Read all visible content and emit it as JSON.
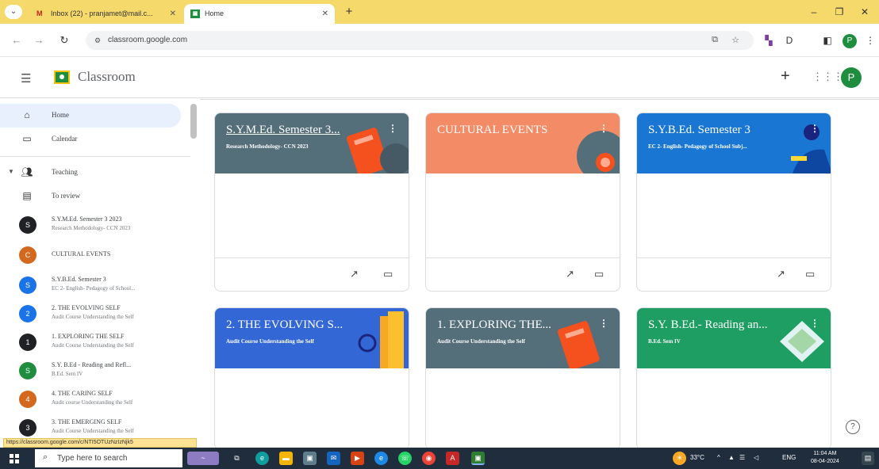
{
  "browser": {
    "tabs": [
      {
        "title": "Inbox (22) - pranjamet@mail.c...",
        "active": false
      },
      {
        "title": "Home",
        "active": true
      }
    ],
    "url": "classroom.google.com",
    "profile_initial": "P"
  },
  "app": {
    "title": "Classroom",
    "avatar_initial": "P"
  },
  "sidebar": {
    "home": "Home",
    "calendar": "Calendar",
    "teaching": "Teaching",
    "to_review": "To review",
    "classes": [
      {
        "initial": "S",
        "color": "#202124",
        "title": "S.Y.M.Ed. Semester 3 2023",
        "subtitle": "Research Methodology- CCN 2023"
      },
      {
        "initial": "C",
        "color": "#d2691e",
        "title": "CULTURAL EVENTS",
        "subtitle": ""
      },
      {
        "initial": "S",
        "color": "#1a73e8",
        "title": "S.Y.B.Ed. Semester 3",
        "subtitle": "EC 2- English- Pedagogy of School..."
      },
      {
        "initial": "2",
        "color": "#1a73e8",
        "title": "2. THE EVOLVING SELF",
        "subtitle": "Audit Course Understanding the Self"
      },
      {
        "initial": "1",
        "color": "#202124",
        "title": "1. EXPLORING THE SELF",
        "subtitle": "Audit Course Understanding the Self"
      },
      {
        "initial": "S",
        "color": "#1e8e3e",
        "title": "S.Y. B.Ed - Reading and Refl...",
        "subtitle": "B.Ed. Sem IV"
      },
      {
        "initial": "4",
        "color": "#d2691e",
        "title": "4. THE CARING SELF",
        "subtitle": "Audit course Understanding the Self"
      },
      {
        "initial": "3",
        "color": "#202124",
        "title": "3. THE EMERGING SELF",
        "subtitle": "Audit Course Understanding the Self"
      }
    ],
    "status_url": "https://classroom.google.com/c/NTI5OTUzNzIzNjk5"
  },
  "cards": [
    {
      "title": "S.Y.M.Ed. Semester 3...",
      "subtitle": "Research Methodology- CCN 2023",
      "color": "#546e7a"
    },
    {
      "title": "CULTURAL EVENTS",
      "subtitle": "",
      "color": "#f28b66"
    },
    {
      "title": "S.Y.B.Ed. Semester 3",
      "subtitle": "EC 2- English- Pedagogy of School Subj...",
      "color": "#1976d2"
    },
    {
      "title": "2. THE EVOLVING S...",
      "subtitle": "Audit Course Understanding the Self",
      "color": "#3367d6"
    },
    {
      "title": "1. EXPLORING THE...",
      "subtitle": "Audit Course Understanding the Self",
      "color": "#546e7a"
    },
    {
      "title": "S.Y. B.Ed.- Reading an...",
      "subtitle": "B.Ed. Sem IV",
      "color": "#1e9e63"
    }
  ],
  "taskbar": {
    "search_placeholder": "Type here to search",
    "temperature": "33°C",
    "language": "ENG",
    "time": "11:04 AM",
    "date": "08-04-2024"
  }
}
